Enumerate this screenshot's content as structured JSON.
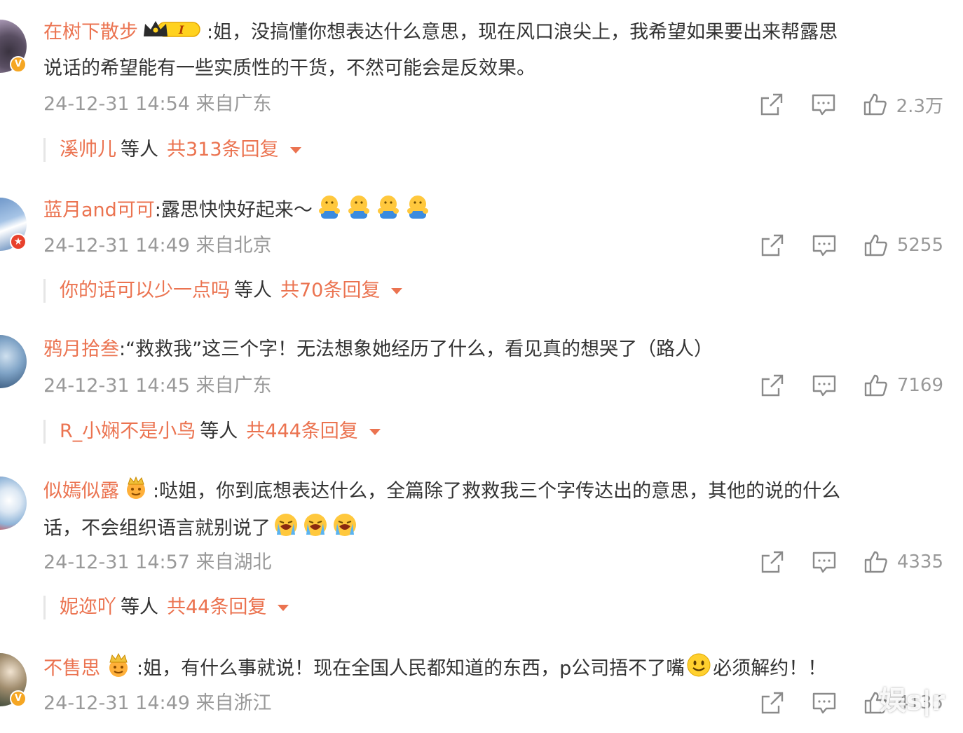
{
  "comments": [
    {
      "username": "在树下散步",
      "text_line1": ":姐，没搞懂你想表达什么意思，现在风口浪尖上，我希望如果要出来帮露思",
      "text_line2": "说话的希望能有一些实质性的干货，不然可能会是反效果。",
      "meta": "24-12-31 14:54 来自广东",
      "likes": "2.3万",
      "reply_user": "溪帅儿",
      "reply_mid": "等人",
      "reply_count": "共313条回复",
      "badge_number": "I"
    },
    {
      "username": "蓝月and可可",
      "text_line1": ":露思快快好起来～",
      "meta": "24-12-31 14:49 来自北京",
      "likes": "5255",
      "reply_user": "你的话可以少一点吗",
      "reply_mid": "等人",
      "reply_count": "共70条回复"
    },
    {
      "username": "鸦月拾叁",
      "text_line1": ":“救救我”这三个字！无法想象她经历了什么，看见真的想哭了（路人）",
      "meta": "24-12-31 14:45 来自广东",
      "likes": "7169",
      "reply_user": "R_小娴不是小鸟",
      "reply_mid": "等人",
      "reply_count": "共444条回复"
    },
    {
      "username": "似嫣似露",
      "text_line1": ":哒姐，你到底想表达什么，全篇除了救救我三个字传达出的意思，其他的说的什么",
      "text_line2": "话，不会组织语言就别说了",
      "meta": "24-12-31 14:57 来自湖北",
      "likes": "4335",
      "reply_user": "妮迩吖",
      "reply_mid": "等人",
      "reply_count": "共44条回复"
    },
    {
      "username": "不售思",
      "text_line1": ":姐，有什么事就说！现在全国人民都知道的东西，p公司捂不了嘴",
      "text_line1b": "必须解约！！",
      "meta": "24-12-31 14:49 来自浙江",
      "likes": "4135"
    }
  ],
  "watermark": "娱s|r",
  "colors": {
    "accent": "#eb7350",
    "meta": "#999999",
    "text": "#333333"
  },
  "icons": [
    "share-icon",
    "comment-icon",
    "like-icon",
    "dropdown-caret-icon",
    "crown-badge-icon",
    "hug-emoji-icon",
    "tear-emoji-icon",
    "smile-emoji-icon"
  ]
}
